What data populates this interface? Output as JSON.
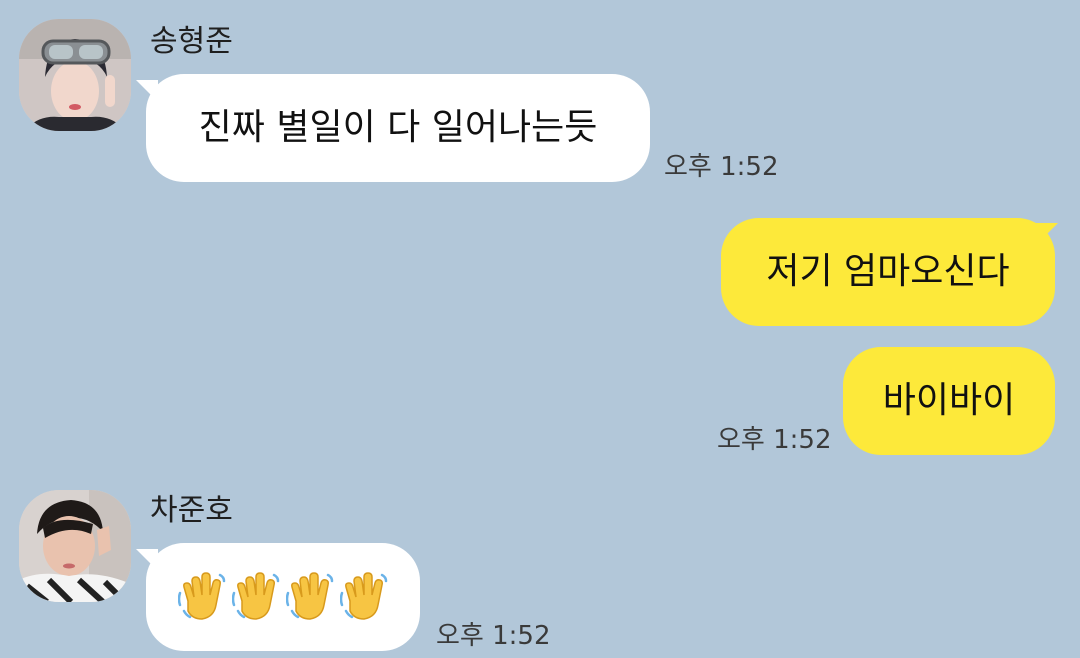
{
  "colors": {
    "background": "#b2c7d9",
    "incoming_bubble": "#ffffff",
    "outgoing_bubble": "#fde93a",
    "time_text": "#3a3a3a"
  },
  "messages": [
    {
      "sender": "송형준",
      "direction": "incoming",
      "text": "진짜 별일이 다 일어나는듯",
      "time": "오후 1:52"
    },
    {
      "direction": "outgoing",
      "text": "저기 엄마오신다"
    },
    {
      "direction": "outgoing",
      "text": "바이바이",
      "time": "오후 1:52"
    },
    {
      "sender": "차준호",
      "direction": "incoming",
      "content": "waving-hand-emoji x4",
      "emoji_count": 4,
      "time": "오후 1:52"
    }
  ]
}
